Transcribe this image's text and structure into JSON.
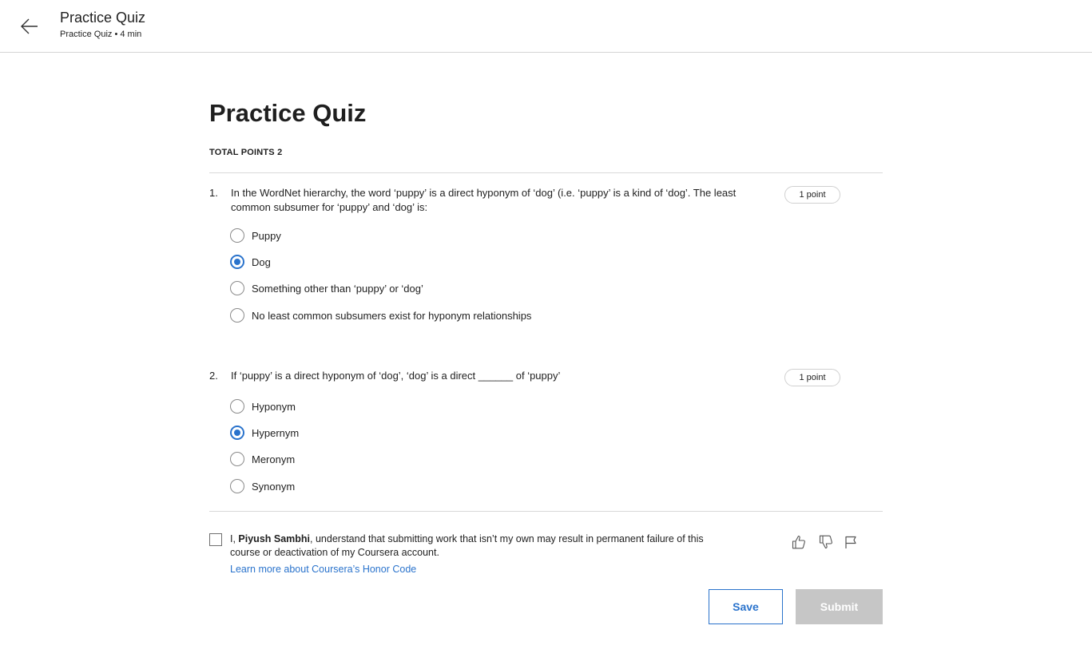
{
  "header": {
    "title": "Practice Quiz",
    "subtitle": "Practice Quiz • 4 min",
    "back_icon": "arrow-left-icon"
  },
  "quiz": {
    "title": "Practice Quiz",
    "total_points": "TOTAL POINTS 2"
  },
  "questions": [
    {
      "number": "1.",
      "text": "In the WordNet hierarchy, the word ‘puppy’ is a direct hyponym of ‘dog’ (i.e. ‘puppy’ is a kind of ‘dog’. The least common subsumer for ‘puppy’ and ‘dog’ is:",
      "points": "1 point",
      "options": [
        {
          "label": "Puppy",
          "selected": false
        },
        {
          "label": "Dog",
          "selected": true
        },
        {
          "label": "Something other than ‘puppy’ or ‘dog’",
          "selected": false
        },
        {
          "label": "No least common subsumers exist for hyponym relationships",
          "selected": false
        }
      ]
    },
    {
      "number": "2.",
      "text": "If ‘puppy’ is a direct hyponym of ‘dog’, ‘dog’ is a direct ______ of ‘puppy’",
      "points": "1 point",
      "options": [
        {
          "label": "Hyponym",
          "selected": false
        },
        {
          "label": "Hypernym",
          "selected": true
        },
        {
          "label": "Meronym",
          "selected": false
        },
        {
          "label": "Synonym",
          "selected": false
        }
      ]
    }
  ],
  "honor": {
    "prefix": "I, ",
    "user_name": "Piyush Sambhi",
    "suffix": ", understand that submitting work that isn’t my own may result in permanent failure of this course or deactivation of my Coursera account.",
    "link_text": "Learn more about Coursera’s Honor Code",
    "checked": false
  },
  "feedback_icons": [
    "thumbs-up-icon",
    "thumbs-down-icon",
    "flag-icon"
  ],
  "buttons": {
    "save": "Save",
    "submit": "Submit"
  },
  "colors": {
    "accent": "#2a73cc",
    "disabled_button": "#c6c6c6",
    "divider": "#d9d9d9"
  }
}
